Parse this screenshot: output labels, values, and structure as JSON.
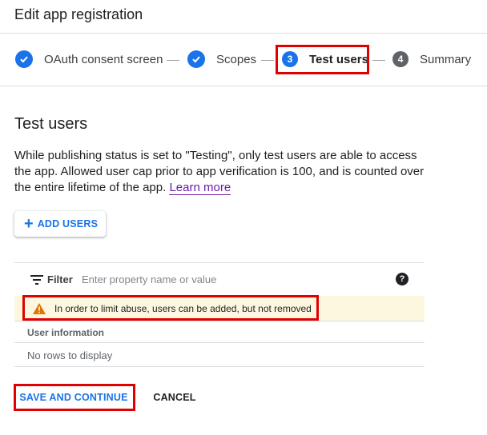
{
  "page": {
    "title": "Edit app registration"
  },
  "stepper": {
    "steps": [
      {
        "number": "",
        "label": "OAuth consent screen",
        "status": "completed"
      },
      {
        "number": "",
        "label": "Scopes",
        "status": "completed"
      },
      {
        "number": "3",
        "label": "Test users",
        "status": "active"
      },
      {
        "number": "4",
        "label": "Summary",
        "status": "pending"
      }
    ]
  },
  "section": {
    "title": "Test users",
    "description": "While publishing status is set to \"Testing\", only test users are able to access the app. Allowed user cap prior to app verification is 100, and is counted over the entire lifetime of the app.",
    "learn_more": "Learn more"
  },
  "add_users_button": {
    "icon": "plus-icon",
    "label": "ADD USERS"
  },
  "table": {
    "filter_label": "Filter",
    "filter_placeholder": "Enter property name or value",
    "warning": "In order to limit abuse, users can be added, but not removed",
    "column_header": "User information",
    "empty_message": "No rows to display"
  },
  "actions": {
    "save_label": "SAVE AND CONTINUE",
    "cancel_label": "CANCEL"
  },
  "colors": {
    "accent": "#1a73e8",
    "highlight": "#e00000",
    "warning_bg": "#fef7e0",
    "warning_icon": "#e37400"
  }
}
